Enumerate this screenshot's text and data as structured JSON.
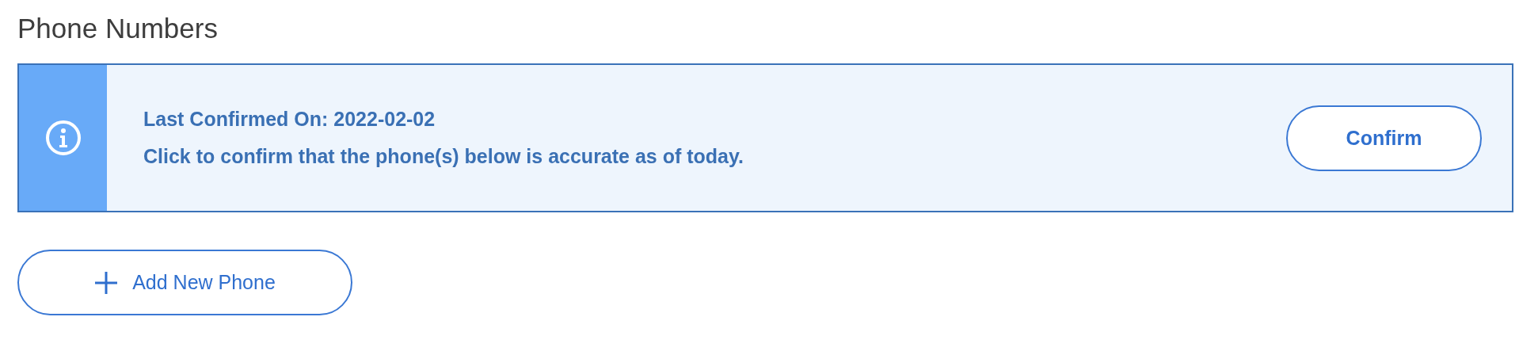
{
  "section_title": "Phone Numbers",
  "notice": {
    "heading": "Last Confirmed On: 2022-02-02",
    "message": "Click to confirm that the phone(s) below is accurate as of today.",
    "button": "Confirm"
  },
  "add_button": {
    "label": "Add New Phone"
  }
}
